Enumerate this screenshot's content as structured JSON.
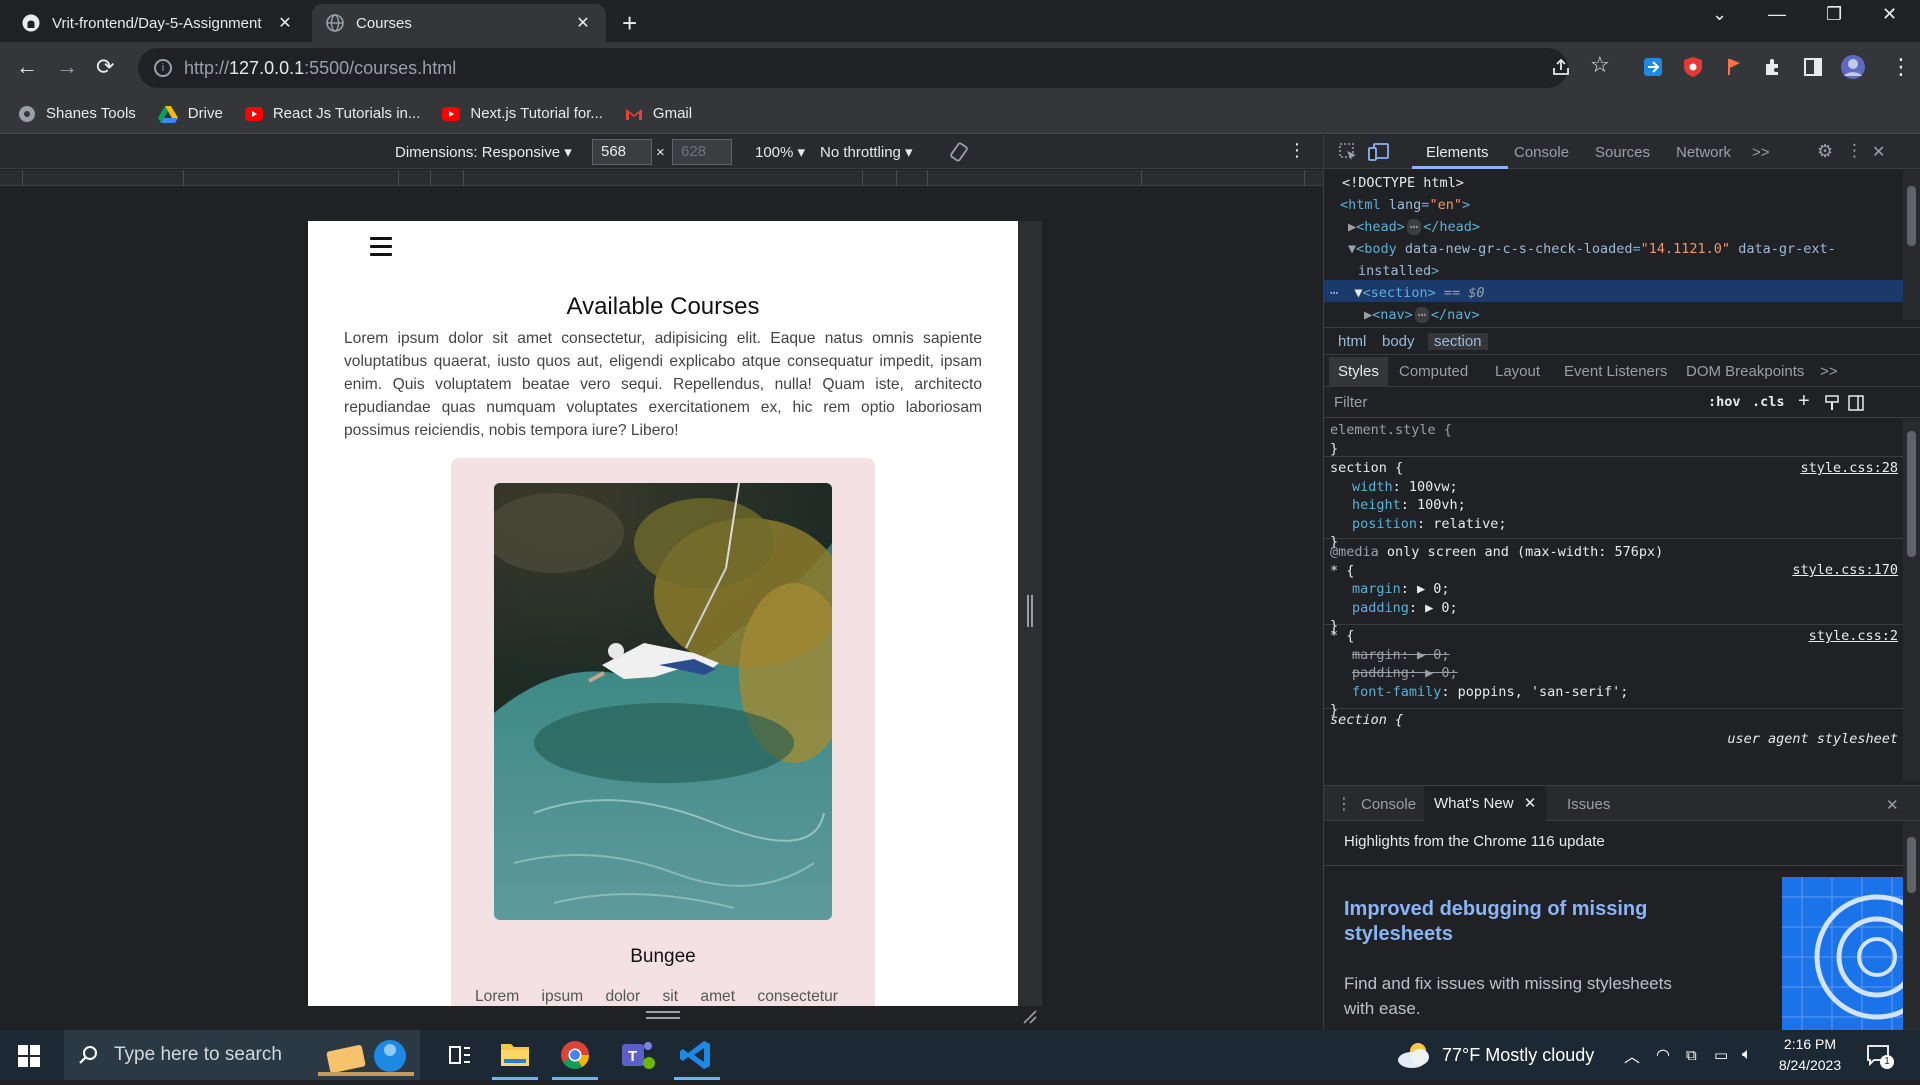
{
  "browser": {
    "tabs": [
      {
        "title": "Vrit-frontend/Day-5-Assignment",
        "icon": "github-icon",
        "active": false
      },
      {
        "title": "Courses",
        "icon": "globe-icon",
        "active": true
      }
    ],
    "url_prefix": "http://",
    "url_host": "127.0.0.1",
    "url_rest": ":5500/courses.html",
    "bookmarks": [
      {
        "label": "Shanes Tools",
        "icon": "globe-icon"
      },
      {
        "label": "Drive",
        "icon": "drive-icon"
      },
      {
        "label": "React Js Tutorials in...",
        "icon": "youtube-icon"
      },
      {
        "label": "Next.js Tutorial for...",
        "icon": "youtube-icon"
      },
      {
        "label": "Gmail",
        "icon": "gmail-icon"
      }
    ]
  },
  "device_toolbar": {
    "dimensions_label": "Dimensions: Responsive",
    "width": "568",
    "height_placeholder": "628",
    "times": "×",
    "zoom": "100%",
    "throttling": "No throttling"
  },
  "page": {
    "heading": "Available Courses",
    "intro": "Lorem ipsum dolor sit amet consectetur, adipisicing elit. Eaque natus omnis sapiente voluptatibus quaerat, iusto quos aut, eligendi explicabo atque consequatur impedit, ipsam enim. Quis voluptatem beatae vero sequi. Repellendus, nulla! Quam iste, architecto repudiandae quas numquam voluptates exercitationem ex, hic rem optio laboriosam possimus reiciendis, nobis tempora iure? Libero!",
    "course_name": "Bungee",
    "course_desc": "Lorem ipsum dolor sit amet consectetur"
  },
  "devtools": {
    "tabs": [
      "Elements",
      "Console",
      "Sources",
      "Network",
      ">>"
    ],
    "dom": {
      "doctype": "<!DOCTYPE html>",
      "html_open": "<html",
      "html_attr": "lang",
      "html_val": "\"en\"",
      "head": "<head>",
      "head_close": "</head>",
      "body_open": "<body",
      "body_attr1": "data-new-gr-c-s-check-loaded",
      "body_val1": "\"14.1121.0\"",
      "body_attr2": "data-gr-ext-",
      "body_attr2b": "installed",
      "section": "<section>",
      "section_marker": "== $0",
      "nav": "<nav>",
      "nav_close": "</nav>",
      "ellipsis": "⋯"
    },
    "breadcrumbs": [
      "html",
      "body",
      "section"
    ],
    "subtabs": [
      "Styles",
      "Computed",
      "Layout",
      "Event Listeners",
      "DOM Breakpoints",
      ">>"
    ],
    "filter_placeholder": "Filter",
    "filter_hov": ":hov",
    "filter_cls": ".cls",
    "rules": {
      "element_style": "element.style {",
      "close": "}",
      "section_sel": "section {",
      "section_src": "style.css:28",
      "section_props": [
        {
          "name": "width",
          "value": "100vw;"
        },
        {
          "name": "height",
          "value": "100vh;"
        },
        {
          "name": "position",
          "value": "relative;"
        }
      ],
      "media_kw": "@media",
      "media_query": "only screen and (max-width: 576px)",
      "star_sel": "* {",
      "media_src": "style.css:170",
      "media_props": [
        {
          "name": "margin",
          "value": "▶ 0;"
        },
        {
          "name": "padding",
          "value": "▶ 0;"
        }
      ],
      "star_src": "style.css:2",
      "star_props": [
        {
          "name": "margin",
          "value": "▶ 0;",
          "struck": true
        },
        {
          "name": "padding",
          "value": "▶ 0;",
          "struck": true
        },
        {
          "name": "font-family",
          "value": "poppins, 'san-serif';",
          "struck": false
        }
      ],
      "next_sel": "section {",
      "next_src": "user agent stylesheet"
    },
    "drawer_tabs": [
      "Console",
      "What's New",
      "Issues"
    ],
    "whats_new_headline": "Highlights from the Chrome 116 update",
    "article_title": "Improved debugging of missing stylesheets",
    "article_text": "Find and fix issues with missing stylesheets with ease."
  },
  "taskbar": {
    "search_placeholder": "Type here to search",
    "weather": "77°F  Mostly cloudy",
    "time": "2:16 PM",
    "date": "8/24/2023",
    "notifications": "1"
  },
  "colors": {
    "accent": "#8ab4f8",
    "selection": "#1a3a6b",
    "card_bg": "#f4e1e4"
  }
}
